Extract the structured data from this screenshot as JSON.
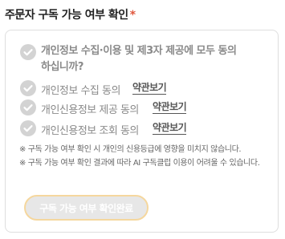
{
  "header": {
    "title": "주문자 구독 가능 여부 확인",
    "required_mark": "*"
  },
  "agree_all": {
    "label": "개인정보 수집·이용 및 제3자 제공에 모두 동의하십니까?"
  },
  "consents": [
    {
      "label": "개인정보 수집 동의",
      "link": "약관보기"
    },
    {
      "label": "개인신용정보 제공 동의",
      "link": "약관보기"
    },
    {
      "label": "개인신용정보 조회 동의",
      "link": "약관보기"
    }
  ],
  "notes": [
    "※ 구독 가능 여부 확인 시 개인의 신용등급에 영향을 미치지 않습니다.",
    "※ 구독 가능 여부 확인 결과에 따라 AI 구독클럽 이용이 어려울 수 있습니다."
  ],
  "button": {
    "label": "구독 가능 여부 확인완료"
  },
  "colors": {
    "required": "#e0573d",
    "check_bg": "#d3d3d3",
    "button_border": "#f5d79e"
  },
  "icons": {
    "check": "check-circle-icon"
  }
}
